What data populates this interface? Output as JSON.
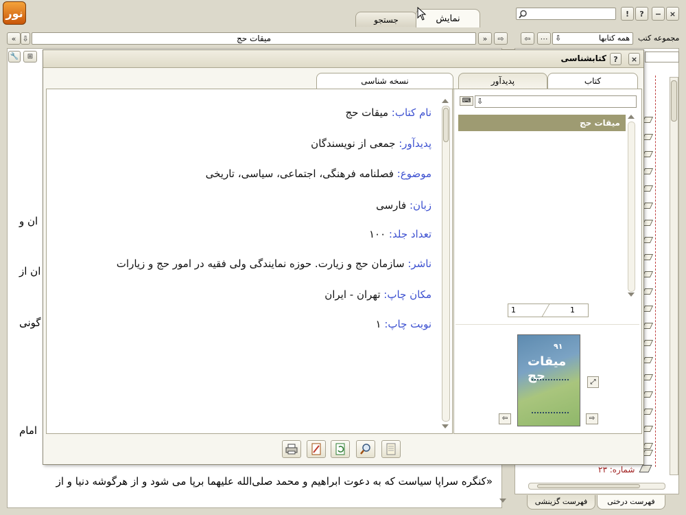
{
  "app": {
    "tabs": {
      "display": "نمایش",
      "search": "جستجو"
    },
    "search_placeholder": "",
    "window_buttons": {
      "help": "?",
      "info": "!",
      "minimize": "−",
      "close": "×"
    }
  },
  "toolbar": {
    "collection_label": "مجموعه کتب",
    "collection_value": "همه کتابها",
    "book_field": "میقات حج"
  },
  "dialog": {
    "title": "کتابشناسی",
    "help": "?",
    "close": "×",
    "left_tab": "نسخه شناسی",
    "right_tabs": {
      "book": "کتاب",
      "author": "پدیدآور"
    },
    "list_item": "میقات حج",
    "pager": {
      "current": "1",
      "total": "1"
    },
    "fields": [
      {
        "label": "نام کتاب:",
        "value": " میقات حج"
      },
      {
        "label": "پدیدآور:",
        "value": " جمعی از نویسندگان"
      },
      {
        "label": "موضوع:",
        "value": " فصلنامه فرهنگی، اجتماعی، سیاسی، تاریخی"
      },
      {
        "label": "زبان:",
        "value": " فارسی"
      },
      {
        "label": "تعداد جلد:",
        "value": " ۱۰۰"
      },
      {
        "label": "ناشر:",
        "value": " سازمان حج و زیارت. حوزه نمایندگی ولی فقیه در امور حج و زیارات"
      },
      {
        "label": "مکان چاپ:",
        "value": " تهران - ایران"
      },
      {
        "label": "نوبت چاپ:",
        "value": " ۱"
      }
    ],
    "cover": {
      "number": "۹۱",
      "title": "میقات حج"
    }
  },
  "background_text": {
    "line1": "ان و",
    "line2": "ان از",
    "line3": "گونی",
    "line4": "امام",
    "bottom": "«کنگره سراپا سیاست که به دعوت ابراهیم و محمد صلی‌الله علیهما برپا می شود و از هرگوشه دنیا و از"
  },
  "tree": {
    "count_label": "شماره: ۲۳",
    "tabs": {
      "tree": "فهرست درختی",
      "selected": "فهرست گزینشی"
    }
  }
}
